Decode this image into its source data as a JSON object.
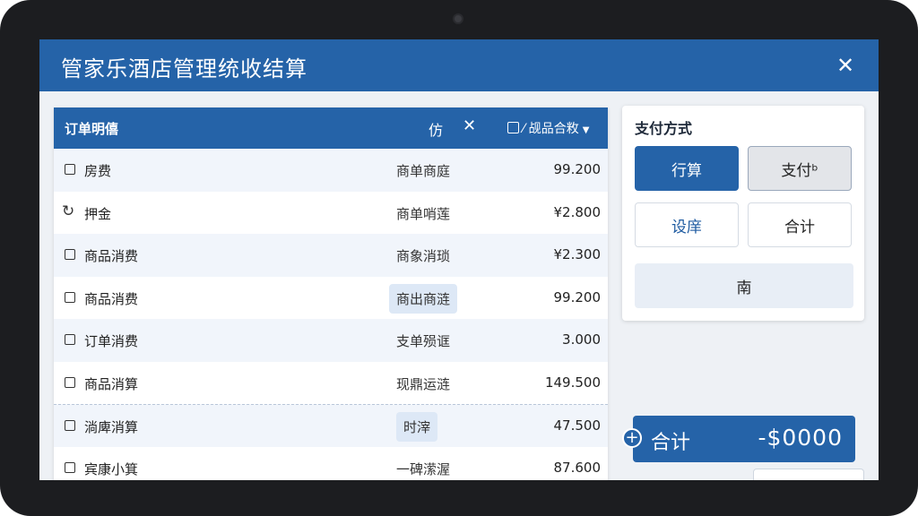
{
  "window": {
    "title": "管家乐酒店管理统收结算"
  },
  "order_panel": {
    "header_title": "订单明僖",
    "header_icon_label": "仿",
    "filter_label": "⁄ 觇品合敉",
    "rows": [
      {
        "name": "房费",
        "status": "商单商庭",
        "amount": "99.200",
        "marker": "checkbox"
      },
      {
        "name": "押金",
        "status": "商单哨莲",
        "amount": "¥2.800",
        "marker": "refresh"
      },
      {
        "name": "商品消费",
        "status": "商象消琐",
        "amount": "¥2.300",
        "marker": "checkbox"
      },
      {
        "name": "商品消费",
        "status": "商出商涟",
        "amount": "99.200",
        "marker": "checkbox"
      },
      {
        "name": "订单消费",
        "status": "支单殒诓",
        "amount": "3.000",
        "marker": "checkbox"
      },
      {
        "name": "商品消算",
        "status": "现鼎运涟",
        "amount": "149.500",
        "marker": "checkbox"
      },
      {
        "name": "淌庳消算",
        "status": "时滓",
        "amount": "47.500",
        "marker": "checkbox"
      },
      {
        "name": "宾康小箕",
        "status": "一碑潆渥",
        "amount": "87.600",
        "marker": "checkbox"
      }
    ]
  },
  "payment": {
    "title": "支付方式",
    "buttons": {
      "b1": "行算",
      "b2": "支付ᵇ",
      "b3": "设庠",
      "b4": "合计",
      "b5": "南"
    }
  },
  "total": {
    "label": "合计",
    "amount": "-$0000"
  },
  "colors": {
    "primary": "#2563a8",
    "row_alt": "#f1f5fb"
  }
}
